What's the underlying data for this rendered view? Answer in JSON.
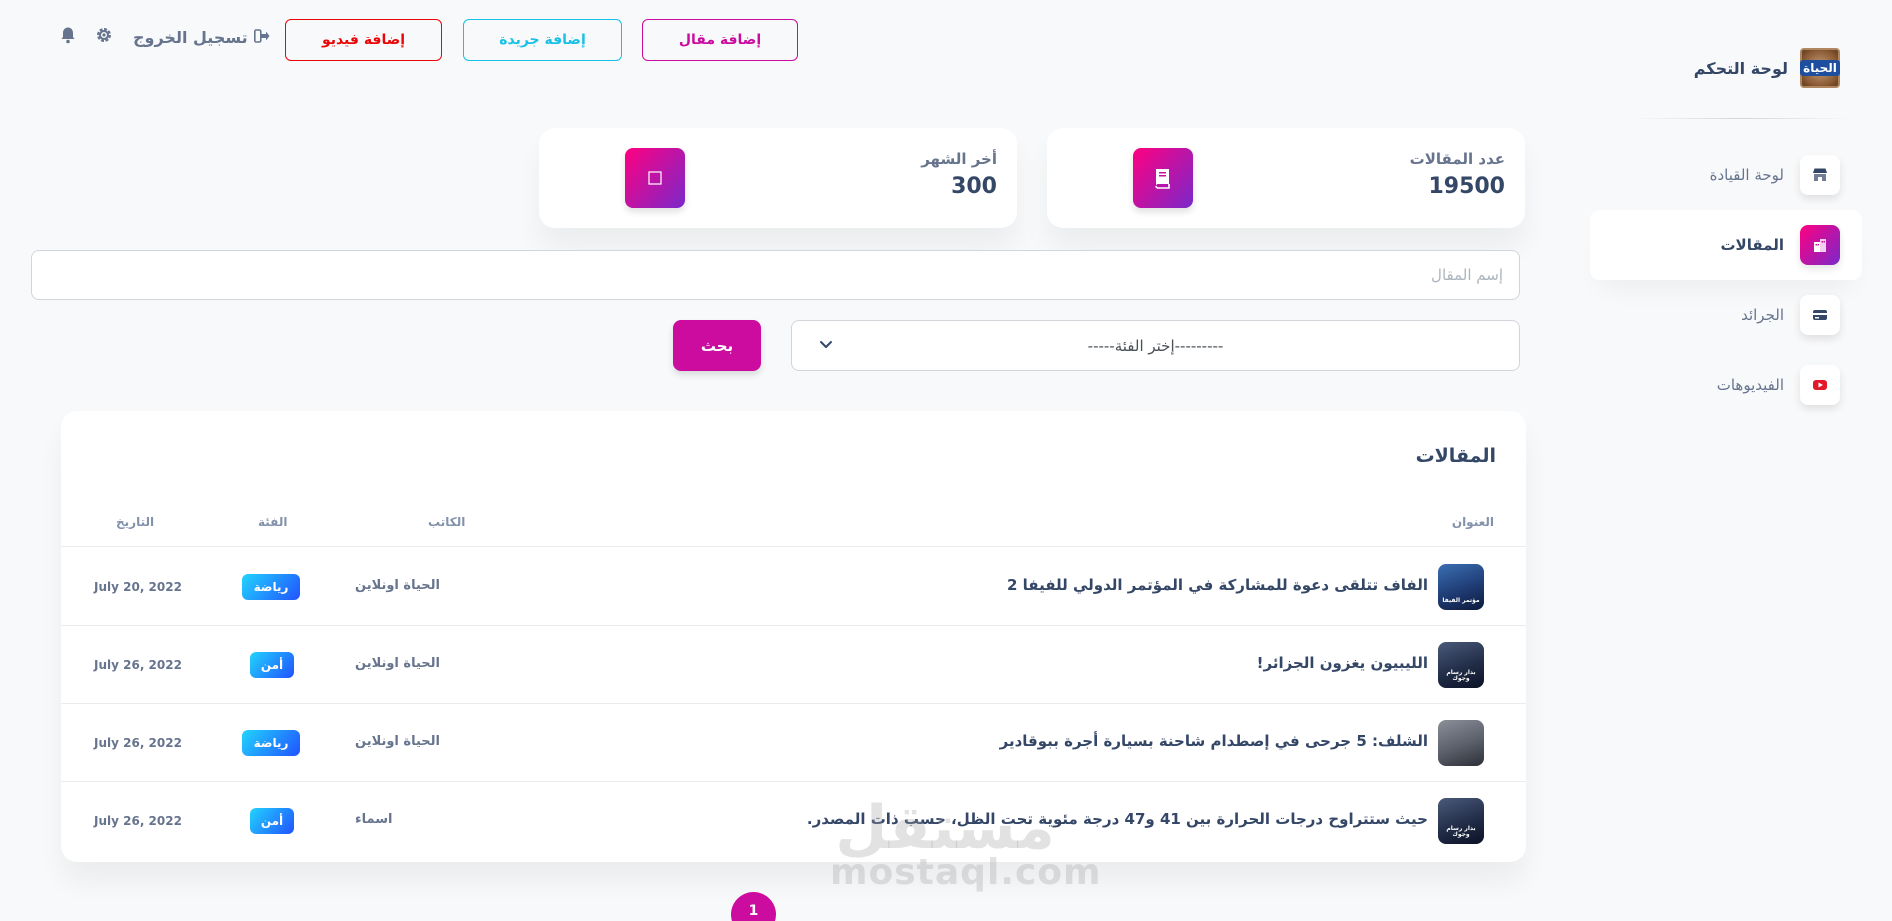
{
  "sidebar": {
    "brand_title": "لوحة التحكم",
    "brand_logo_text": "الحياة",
    "items": [
      {
        "label": "لوحة القيادة",
        "icon": "shop-icon",
        "active": false
      },
      {
        "label": "المقالات",
        "icon": "office-icon",
        "active": true
      },
      {
        "label": "الجرائد",
        "icon": "credit-card-icon",
        "active": false
      },
      {
        "label": "الفيديوهات",
        "icon": "youtube-icon",
        "active": false
      }
    ]
  },
  "topbar": {
    "add_article": "إضافة مقال",
    "add_newspaper": "إضافة جريدة",
    "add_video": "إضافة فيديو",
    "logout": "تسجيل الخروج"
  },
  "stats": {
    "articles_label": "عدد المقالات",
    "articles_value": "19500",
    "month_label": "أخر الشهر",
    "month_value": "300"
  },
  "search": {
    "placeholder": "إسم المقال",
    "category_placeholder": "---------إختر الفئة-----",
    "button": "بحث"
  },
  "table": {
    "title": "المقالات",
    "headers": {
      "title": "العنوان",
      "author": "الكاتب",
      "category": "الفئة",
      "date": "التاريخ"
    },
    "rows": [
      {
        "title": "الفاف تتلقى دعوة للمشاركة في المؤتمر الدولي للفيفا 2",
        "author": "الحياة اونلاين",
        "category": "رياضة",
        "date": "July 20, 2022",
        "thumb_text": "مؤتمر الفيفا"
      },
      {
        "title": "الليبيون يغزون الجزائر!",
        "author": "الحياة اونلاين",
        "category": "أمن",
        "date": "July 26, 2022",
        "thumb_text": "بدار رسام وجوك"
      },
      {
        "title": "الشلف: 5 جرحى في إصطدام شاحنة بسيارة أجرة ببوقادير",
        "author": "الحياة اونلاين",
        "category": "رياضة",
        "date": "July 26, 2022",
        "thumb_text": ""
      },
      {
        "title": "حيث ستتراوح درجات الحرارة بين 41 و47 درجة مئوية تحت الظل، حسب ذات المصدر.",
        "author": "اسماء",
        "category": "أمن",
        "date": "July 26, 2022",
        "thumb_text": "بدار رسام وجوك"
      }
    ]
  },
  "pagination": {
    "current": "1"
  },
  "watermark": {
    "ar": "مستقل",
    "en": "mostaql.com"
  },
  "colors": {
    "primary": "#cb0c9f",
    "info": "#17c1e8",
    "danger": "#ea0606",
    "gradient_from": "#7928ca",
    "gradient_to": "#ff0080"
  }
}
